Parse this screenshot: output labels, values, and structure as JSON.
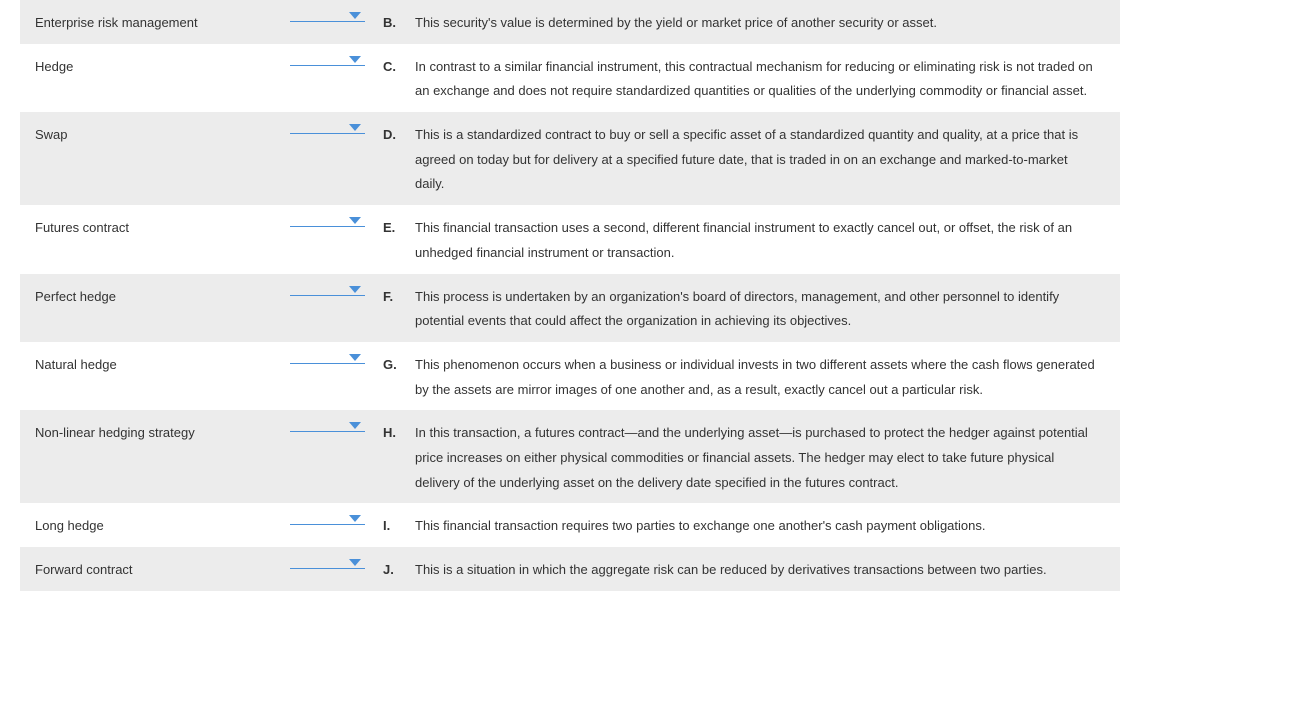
{
  "rows": [
    {
      "term": "Enterprise risk management",
      "letter": "B.",
      "definition": "This security's value is determined by the yield or market price of another security or asset."
    },
    {
      "term": "Hedge",
      "letter": "C.",
      "definition": "In contrast to a similar financial instrument, this contractual mechanism for reducing or eliminating risk is not traded on an exchange and does not require standardized quantities or qualities of the underlying commodity or financial asset."
    },
    {
      "term": "Swap",
      "letter": "D.",
      "definition": "This is a standardized contract to buy or sell a specific asset of a standardized quantity and quality, at a price that is agreed on today but for delivery at a specified future date, that is traded in on an exchange and marked-to-market daily."
    },
    {
      "term": "Futures contract",
      "letter": "E.",
      "definition": "This financial transaction uses a second, different financial instrument to exactly cancel out, or offset, the risk of an unhedged financial instrument or transaction."
    },
    {
      "term": "Perfect hedge",
      "letter": "F.",
      "definition": "This process is undertaken by an organization's board of directors, management, and other personnel to identify potential events that could affect the organization in achieving its objectives."
    },
    {
      "term": "Natural hedge",
      "letter": "G.",
      "definition": "This phenomenon occurs when a business or individual invests in two different assets where the cash flows generated by the assets are mirror images of one another and, as a result, exactly cancel out a particular risk."
    },
    {
      "term": "Non-linear hedging strategy",
      "letter": "H.",
      "definition": "In this transaction, a futures contract—and the underlying asset—is purchased to protect the hedger against potential price increases on either physical commodities or financial assets. The hedger may elect to take future physical delivery of the underlying asset on the delivery date specified in the futures contract."
    },
    {
      "term": "Long hedge",
      "letter": "I.",
      "definition": "This financial transaction requires two parties to exchange one another's cash payment obligations."
    },
    {
      "term": "Forward contract",
      "letter": "J.",
      "definition": "This is a situation in which the aggregate risk can be reduced by derivatives transactions between two parties."
    }
  ]
}
